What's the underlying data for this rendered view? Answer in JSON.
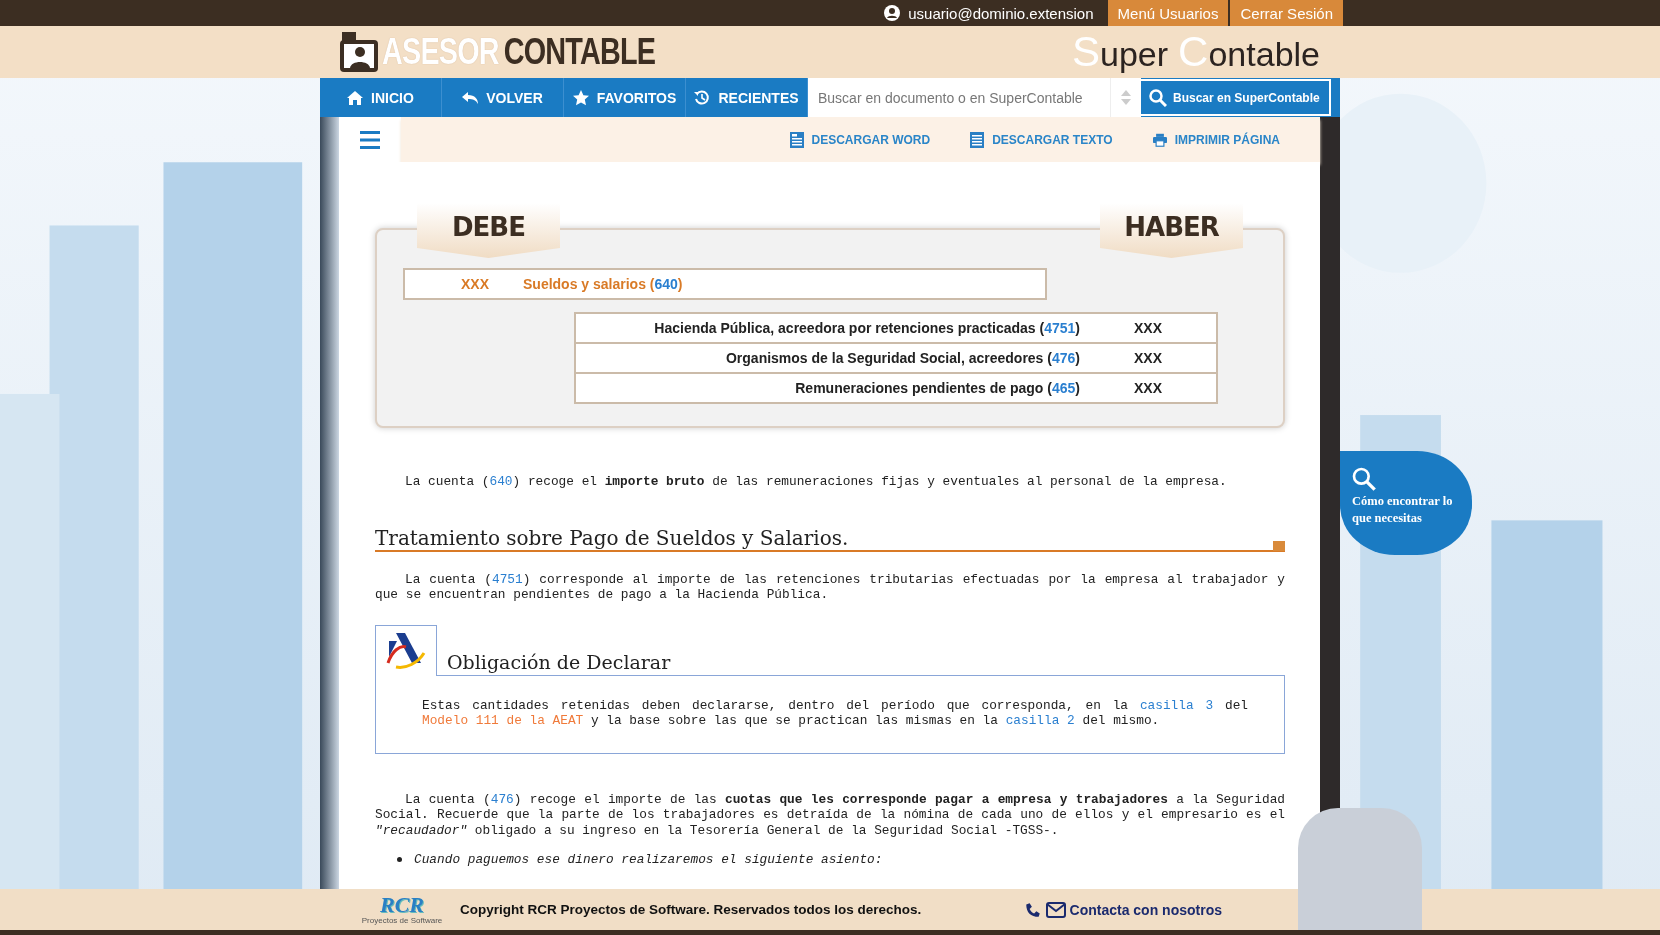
{
  "top_bar": {
    "user_email": "usuario@dominio.extension",
    "buttons": [
      "Menú Usuarios",
      "Cerrar Sesión"
    ]
  },
  "header": {
    "logo_left": {
      "first": "ASESOR",
      "second": "CONTABLE"
    },
    "logo_right": {
      "first": "Super",
      "second": "Contable"
    }
  },
  "nav": {
    "items": [
      {
        "label": "INICIO"
      },
      {
        "label": "VOLVER"
      },
      {
        "label": "FAVORITOS"
      },
      {
        "label": "RECIENTES"
      }
    ],
    "search": {
      "placeholder": "Buscar en documento o en SuperContable"
    },
    "search_button": "Buscar en SuperContable"
  },
  "toolbar": {
    "actions": [
      {
        "label": "DESCARGAR WORD"
      },
      {
        "label": "DESCARGAR TEXTO"
      },
      {
        "label": "IMPRIMIR PÁGINA"
      }
    ]
  },
  "ledger": {
    "debe_label": "DEBE",
    "haber_label": "HABER",
    "debit": {
      "amount": "XXX",
      "before": "Sueldos y salarios (",
      "code": "640",
      "after": ")"
    },
    "credits": [
      {
        "before": "Hacienda Pública, acreedora por retenciones practicadas (",
        "code": "4751",
        "after": ")",
        "amount": "XXX"
      },
      {
        "before": "Organismos de la Seguridad Social, acreedores (",
        "code": "476",
        "after": ")",
        "amount": "XXX"
      },
      {
        "before": "Remuneraciones pendientes de pago (",
        "code": "465",
        "after": ")",
        "amount": "XXX"
      }
    ]
  },
  "article": [
    {
      "kind": "paragraph",
      "segments": [
        {
          "kind": "text",
          "text": "La cuenta ("
        },
        {
          "kind": "link",
          "text": "640"
        },
        {
          "kind": "text",
          "text": ") recoge el **importe bruto** de las remuneraciones fijas y eventuales al personal de la empresa."
        }
      ]
    },
    {
      "kind": "heading",
      "text": "Tratamiento sobre Pago de Sueldos y Salarios."
    },
    {
      "kind": "paragraph",
      "segments": [
        {
          "kind": "text",
          "text": "La cuenta ("
        },
        {
          "kind": "link",
          "text": "4751"
        },
        {
          "kind": "text",
          "text": ") corresponde al importe de las retenciones tributarias efectuadas por la empresa al trabajador y que se encuentran pendientes de pago a la Hacienda Pública."
        }
      ]
    },
    {
      "kind": "notice",
      "title": "Obligación de Declarar",
      "segments": [
        {
          "kind": "text",
          "text": "Estas cantidades retenidas deben declararse, dentro del período que corresponda, en la "
        },
        {
          "kind": "link",
          "text": "casilla 3"
        },
        {
          "kind": "text",
          "text": " del "
        },
        {
          "kind": "external_link",
          "text": "Modelo 111 de la AEAT"
        },
        {
          "kind": "text",
          "text": " y la base sobre las que se practican las mismas en la "
        },
        {
          "kind": "link",
          "text": "casilla 2"
        },
        {
          "kind": "text",
          "text": " del mismo."
        }
      ]
    },
    {
      "kind": "paragraph",
      "segments": [
        {
          "kind": "text",
          "text": "La cuenta ("
        },
        {
          "kind": "link",
          "text": "476"
        },
        {
          "kind": "text",
          "text": ") recoge el importe de las **cuotas que les corresponde pagar a empresa y trabajadores** a la Seguridad Social. Recuerde que la parte de los trabajadores es detraída de la nómina de cada uno de ellos y el empresario es el *\"recaudador\"* obligado a su ingreso en la Tesorería General de la Seguridad Social -TGSS-."
        }
      ]
    },
    {
      "kind": "bullet",
      "text": "Cuando paguemos ese dinero realizaremos el siguiente asiento:"
    }
  ],
  "help_bubble": "Cómo encontrar lo que necesitas",
  "footer": {
    "logo": "RCR",
    "logo_caption": "Proyectos de Software",
    "copyright": "Copyright RCR Proyectos de Software. Reservados todos los derechos.",
    "contact": "Contacta con nosotros"
  }
}
